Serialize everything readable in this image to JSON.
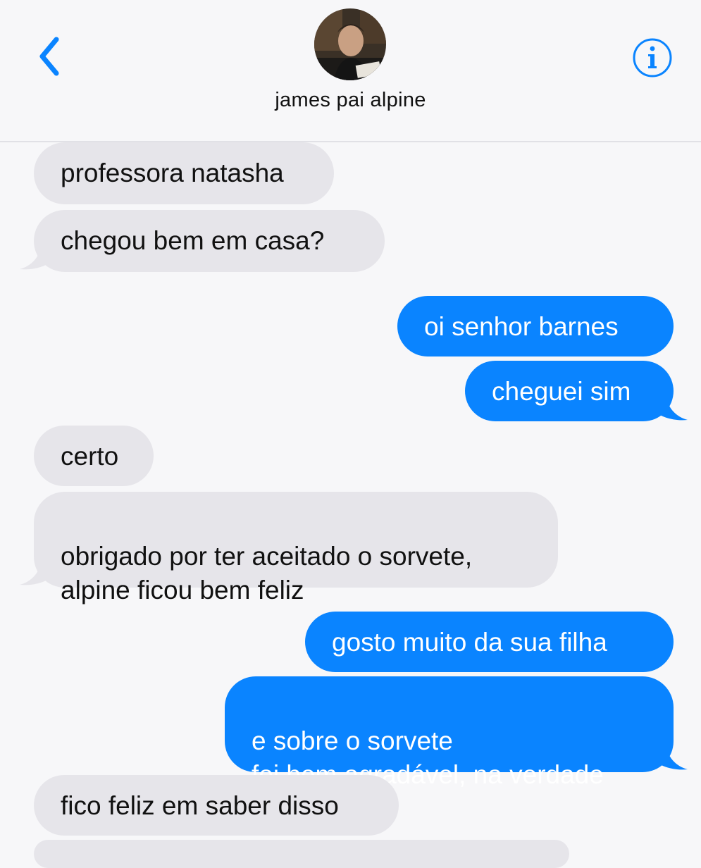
{
  "header": {
    "contact_name": "james pai alpine",
    "back_icon": "chevron-left-icon",
    "info_icon": "info-icon",
    "accent_color": "#0a84ff"
  },
  "messages": [
    {
      "direction": "incoming",
      "text": "professora natasha"
    },
    {
      "direction": "incoming",
      "text": "chegou bem em casa?"
    },
    {
      "direction": "outgoing",
      "text": "oi senhor barnes"
    },
    {
      "direction": "outgoing",
      "text": "cheguei sim"
    },
    {
      "direction": "incoming",
      "text": "certo"
    },
    {
      "direction": "incoming",
      "text": "obrigado por ter aceitado o sorvete,\nalpine ficou bem feliz"
    },
    {
      "direction": "outgoing",
      "text": "gosto muito da sua filha"
    },
    {
      "direction": "outgoing",
      "text": "e sobre o sorvete\nfoi bem agradável, na verdade"
    },
    {
      "direction": "incoming",
      "text": "fico feliz em saber disso"
    }
  ],
  "colors": {
    "incoming_bubble": "#e6e5ea",
    "outgoing_bubble": "#0a84ff",
    "background": "#f7f7f9"
  }
}
